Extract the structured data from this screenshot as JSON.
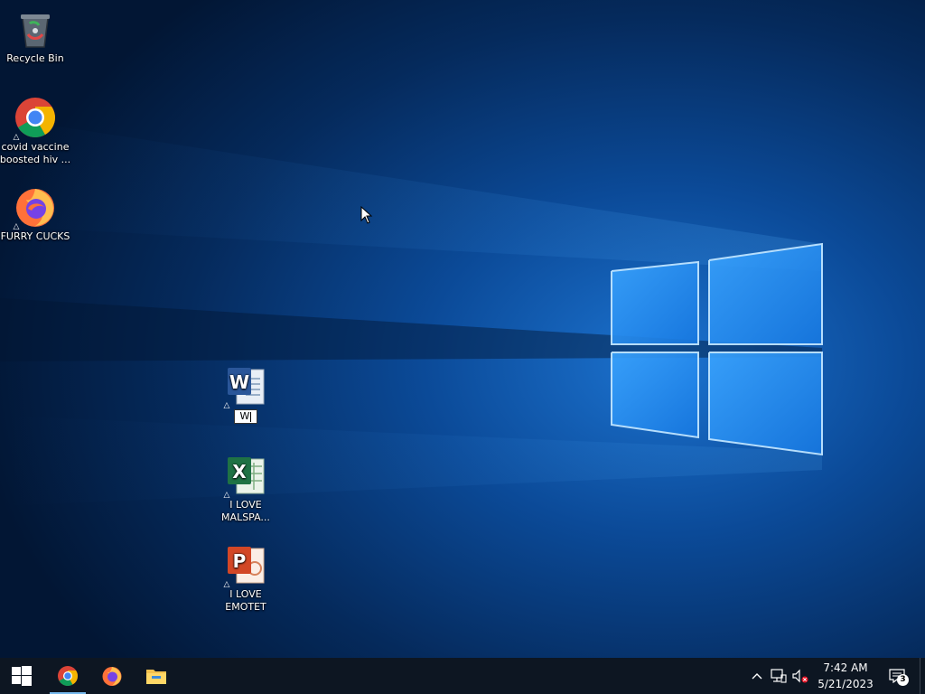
{
  "desktop": {
    "icons": [
      {
        "id": "recycle-bin",
        "label": "Recycle Bin",
        "icon": "recycle-bin-icon"
      },
      {
        "id": "chrome-shortcut",
        "label": "covid vaccine boosted hiv ...",
        "icon": "chrome-icon"
      },
      {
        "id": "firefox-shortcut",
        "label": "FURRY CUCKS",
        "icon": "firefox-icon"
      },
      {
        "id": "word-document",
        "label": "",
        "rename_value": "W",
        "icon": "word-icon"
      },
      {
        "id": "excel-document",
        "label": "I LOVE MALSPA...",
        "icon": "excel-icon"
      },
      {
        "id": "powerpoint-document",
        "label": "I LOVE EMOTET",
        "icon": "powerpoint-icon"
      }
    ]
  },
  "taskbar": {
    "start": "windows-start-icon",
    "pinned": [
      "chrome-icon",
      "firefox-icon",
      "file-explorer-icon"
    ],
    "active": "chrome-icon",
    "tray": {
      "overflow_icon": "chevron-up-icon",
      "network_icon": "network-icon",
      "volume_icon": "volume-muted-icon",
      "time": "7:42 AM",
      "date": "5/21/2023",
      "notification_count": "3"
    }
  },
  "colors": {
    "wallpaper_dark": "#031a3d",
    "wallpaper_light": "#2e8de8",
    "taskbar": "#0d1622",
    "active_indicator": "#76b9ed"
  }
}
